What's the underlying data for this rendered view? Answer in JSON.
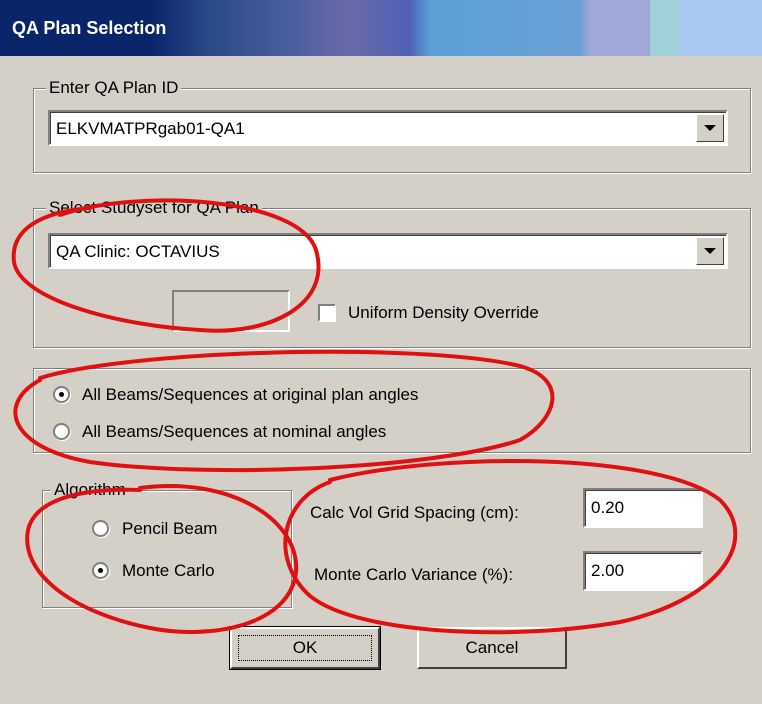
{
  "window": {
    "title": "QA Plan Selection"
  },
  "plan_id_group": {
    "legend": "Enter QA Plan ID",
    "selected": "ELKVMATPRgab01-QA1"
  },
  "studyset_group": {
    "legend": "Select Studyset for QA Plan",
    "selected": "QA Clinic:  OCTAVIUS",
    "density_box_value": "",
    "uniform_density_label": "Uniform Density Override",
    "uniform_density_checked": false
  },
  "beam_options": {
    "original_label": "All Beams/Sequences at original plan angles",
    "nominal_label": "All Beams/Sequences at nominal angles",
    "selected": "original"
  },
  "algorithm": {
    "legend": "Algorithm",
    "pencil_label": "Pencil Beam",
    "monte_label": "Monte Carlo",
    "selected": "monte"
  },
  "calc": {
    "grid_label": "Calc Vol Grid Spacing (cm):",
    "grid_value": "0.20",
    "variance_label": "Monte Carlo Variance (%):",
    "variance_value": "2.00"
  },
  "buttons": {
    "ok": "OK",
    "cancel": "Cancel"
  },
  "annotation_color": "#e01010"
}
